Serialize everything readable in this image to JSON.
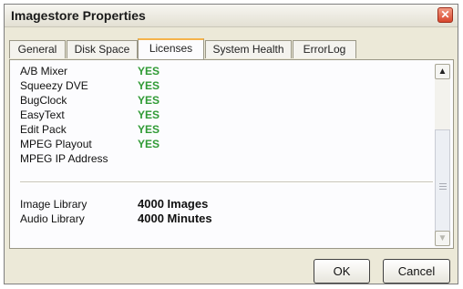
{
  "window": {
    "title": "Imagestore Properties"
  },
  "tabs": [
    {
      "label": "General"
    },
    {
      "label": "Disk Space"
    },
    {
      "label": "Licenses"
    },
    {
      "label": "System Health"
    },
    {
      "label": "ErrorLog"
    }
  ],
  "active_tab": "Licenses",
  "licenses": [
    {
      "label": "A/B Mixer",
      "value": "YES"
    },
    {
      "label": "Squeezy DVE",
      "value": "YES"
    },
    {
      "label": "BugClock",
      "value": "YES"
    },
    {
      "label": "EasyText",
      "value": "YES"
    },
    {
      "label": "Edit Pack",
      "value": "YES"
    },
    {
      "label": "MPEG Playout",
      "value": "YES"
    },
    {
      "label": "MPEG IP Address",
      "value": ""
    }
  ],
  "libraries": [
    {
      "label": "Image Library",
      "value": "4000 Images"
    },
    {
      "label": "Audio Library",
      "value": "4000 Minutes"
    }
  ],
  "buttons": {
    "ok": "OK",
    "cancel": "Cancel"
  },
  "colors": {
    "yes": "#2f9a34",
    "active_tab_accent": "#f5b34a",
    "dialog_bg": "#ece9d8"
  }
}
